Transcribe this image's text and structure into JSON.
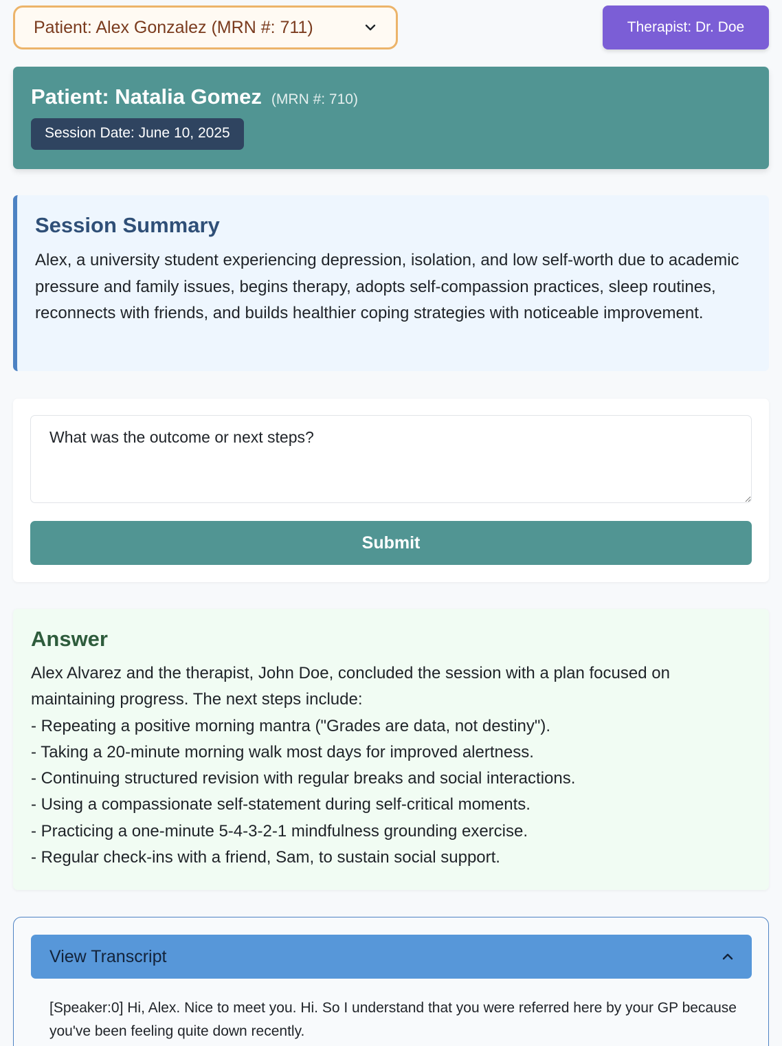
{
  "patient_select": {
    "selected": "Patient: Alex Gonzalez (MRN #: 711)"
  },
  "therapist": {
    "label": "Therapist: Dr. Doe"
  },
  "header": {
    "patient_name": "Patient: Natalia Gomez",
    "mrn": "(MRN #: 710)",
    "session_date": "Session Date: June 10, 2025"
  },
  "summary": {
    "title": "Session Summary",
    "text": "Alex, a university student experiencing depression, isolation, and low self-worth due to academic pressure and family issues, begins therapy, adopts self-compassion practices, sleep routines, reconnects with friends, and builds healthier coping strategies with noticeable improvement."
  },
  "question": {
    "value": "What was the outcome or next steps?",
    "submit_label": "Submit"
  },
  "answer": {
    "title": "Answer",
    "lines": [
      "Alex Alvarez and the therapist, John Doe, concluded the session with a plan focused on maintaining progress. The next steps include:",
      "- Repeating a positive morning mantra (\"Grades are data, not destiny\").",
      "- Taking a 20-minute morning walk most days for improved alertness.",
      "- Continuing structured revision with regular breaks and social interactions.",
      "- Using a compassionate self-statement during self-critical moments.",
      "- Practicing a one-minute 5-4-3-2-1 mindfulness grounding exercise.",
      "- Regular check-ins with a friend, Sam, to sustain social support."
    ]
  },
  "transcript": {
    "toggle_label": "View Transcript",
    "text": "[Speaker:0] Hi, Alex. Nice to meet you. Hi. So I understand that you were referred here by your GP because you've been feeling quite down recently."
  },
  "icons": {
    "select_chevron": "chevron-down-icon",
    "transcript_chevron": "chevron-up-icon"
  },
  "colors": {
    "teal": "#519593",
    "purple": "#7b5ed6",
    "navy_badge": "#2f4460",
    "summary_accent": "#4d82c3",
    "transcript_blue": "#5797d9",
    "select_border": "#ecb46a"
  }
}
